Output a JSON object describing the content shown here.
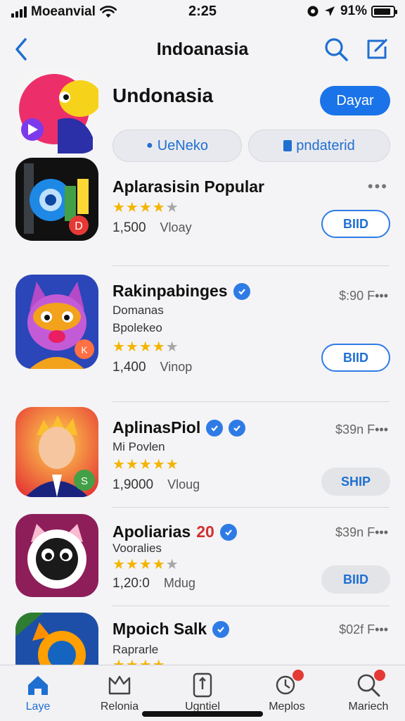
{
  "status_bar": {
    "carrier": "Moeanvial",
    "time": "2:25",
    "battery": "91%"
  },
  "nav": {
    "title": "Indoanasia"
  },
  "featured": {
    "name": "Undonasia",
    "get_label": "Dayar",
    "chip_left": "UeNeko",
    "chip_right": "pndaterid",
    "colors": {
      "accent": "#1a73e8"
    }
  },
  "apps": [
    {
      "name": "Aplarasisin Popular",
      "subtitle": "",
      "subtitle2": "",
      "rating": 4,
      "rating_max": 5,
      "count": "1,500",
      "downloads": "Vloay",
      "price": "",
      "more": "•••",
      "button_label": "BIID",
      "button_style": "outline",
      "verified_badges": 0
    },
    {
      "name": "Rakinpabinges",
      "subtitle": "Domanas",
      "subtitle2": "Bpolekeo",
      "rating": 4.5,
      "rating_max": 5,
      "count": "1,400",
      "downloads": "Vinop",
      "price": "$:90 F•••",
      "button_label": "BIID",
      "button_style": "outline",
      "verified_badges": 1
    },
    {
      "name": "AplinasPiol",
      "subtitle": "Mi Povlen",
      "subtitle2": "",
      "rating": 5,
      "rating_max": 5,
      "count": "1,9000",
      "downloads": "Vloug",
      "price": "$39n F•••",
      "button_label": "SHIP",
      "button_style": "gray",
      "verified_badges": 2
    },
    {
      "name": "Apoliarias",
      "name_suffix": "20",
      "subtitle": "Vooralies",
      "subtitle2": "",
      "rating": 4.5,
      "rating_max": 5,
      "count": "1,20:0",
      "downloads": "Mdug",
      "price": "$39n F•••",
      "button_label": "BIID",
      "button_style": "gray",
      "verified_badges": 1
    },
    {
      "name": "Mpoich Salk",
      "subtitle": "Raprarle",
      "subtitle2": "",
      "rating": 4,
      "rating_max": 5,
      "count": "",
      "downloads": "",
      "price": "$02f F•••",
      "button_label": "",
      "button_style": "outline",
      "verified_badges": 1
    }
  ],
  "tabs": [
    {
      "label": "Laye",
      "icon": "home-icon",
      "active": true
    },
    {
      "label": "Relonia",
      "icon": "games-icon",
      "active": false
    },
    {
      "label": "Ugntiel",
      "icon": "apps-icon",
      "active": false
    },
    {
      "label": "Meplos",
      "icon": "arcade-icon",
      "active": false,
      "badge": true
    },
    {
      "label": "Mariech",
      "icon": "search-icon",
      "active": false,
      "badge": true
    }
  ]
}
